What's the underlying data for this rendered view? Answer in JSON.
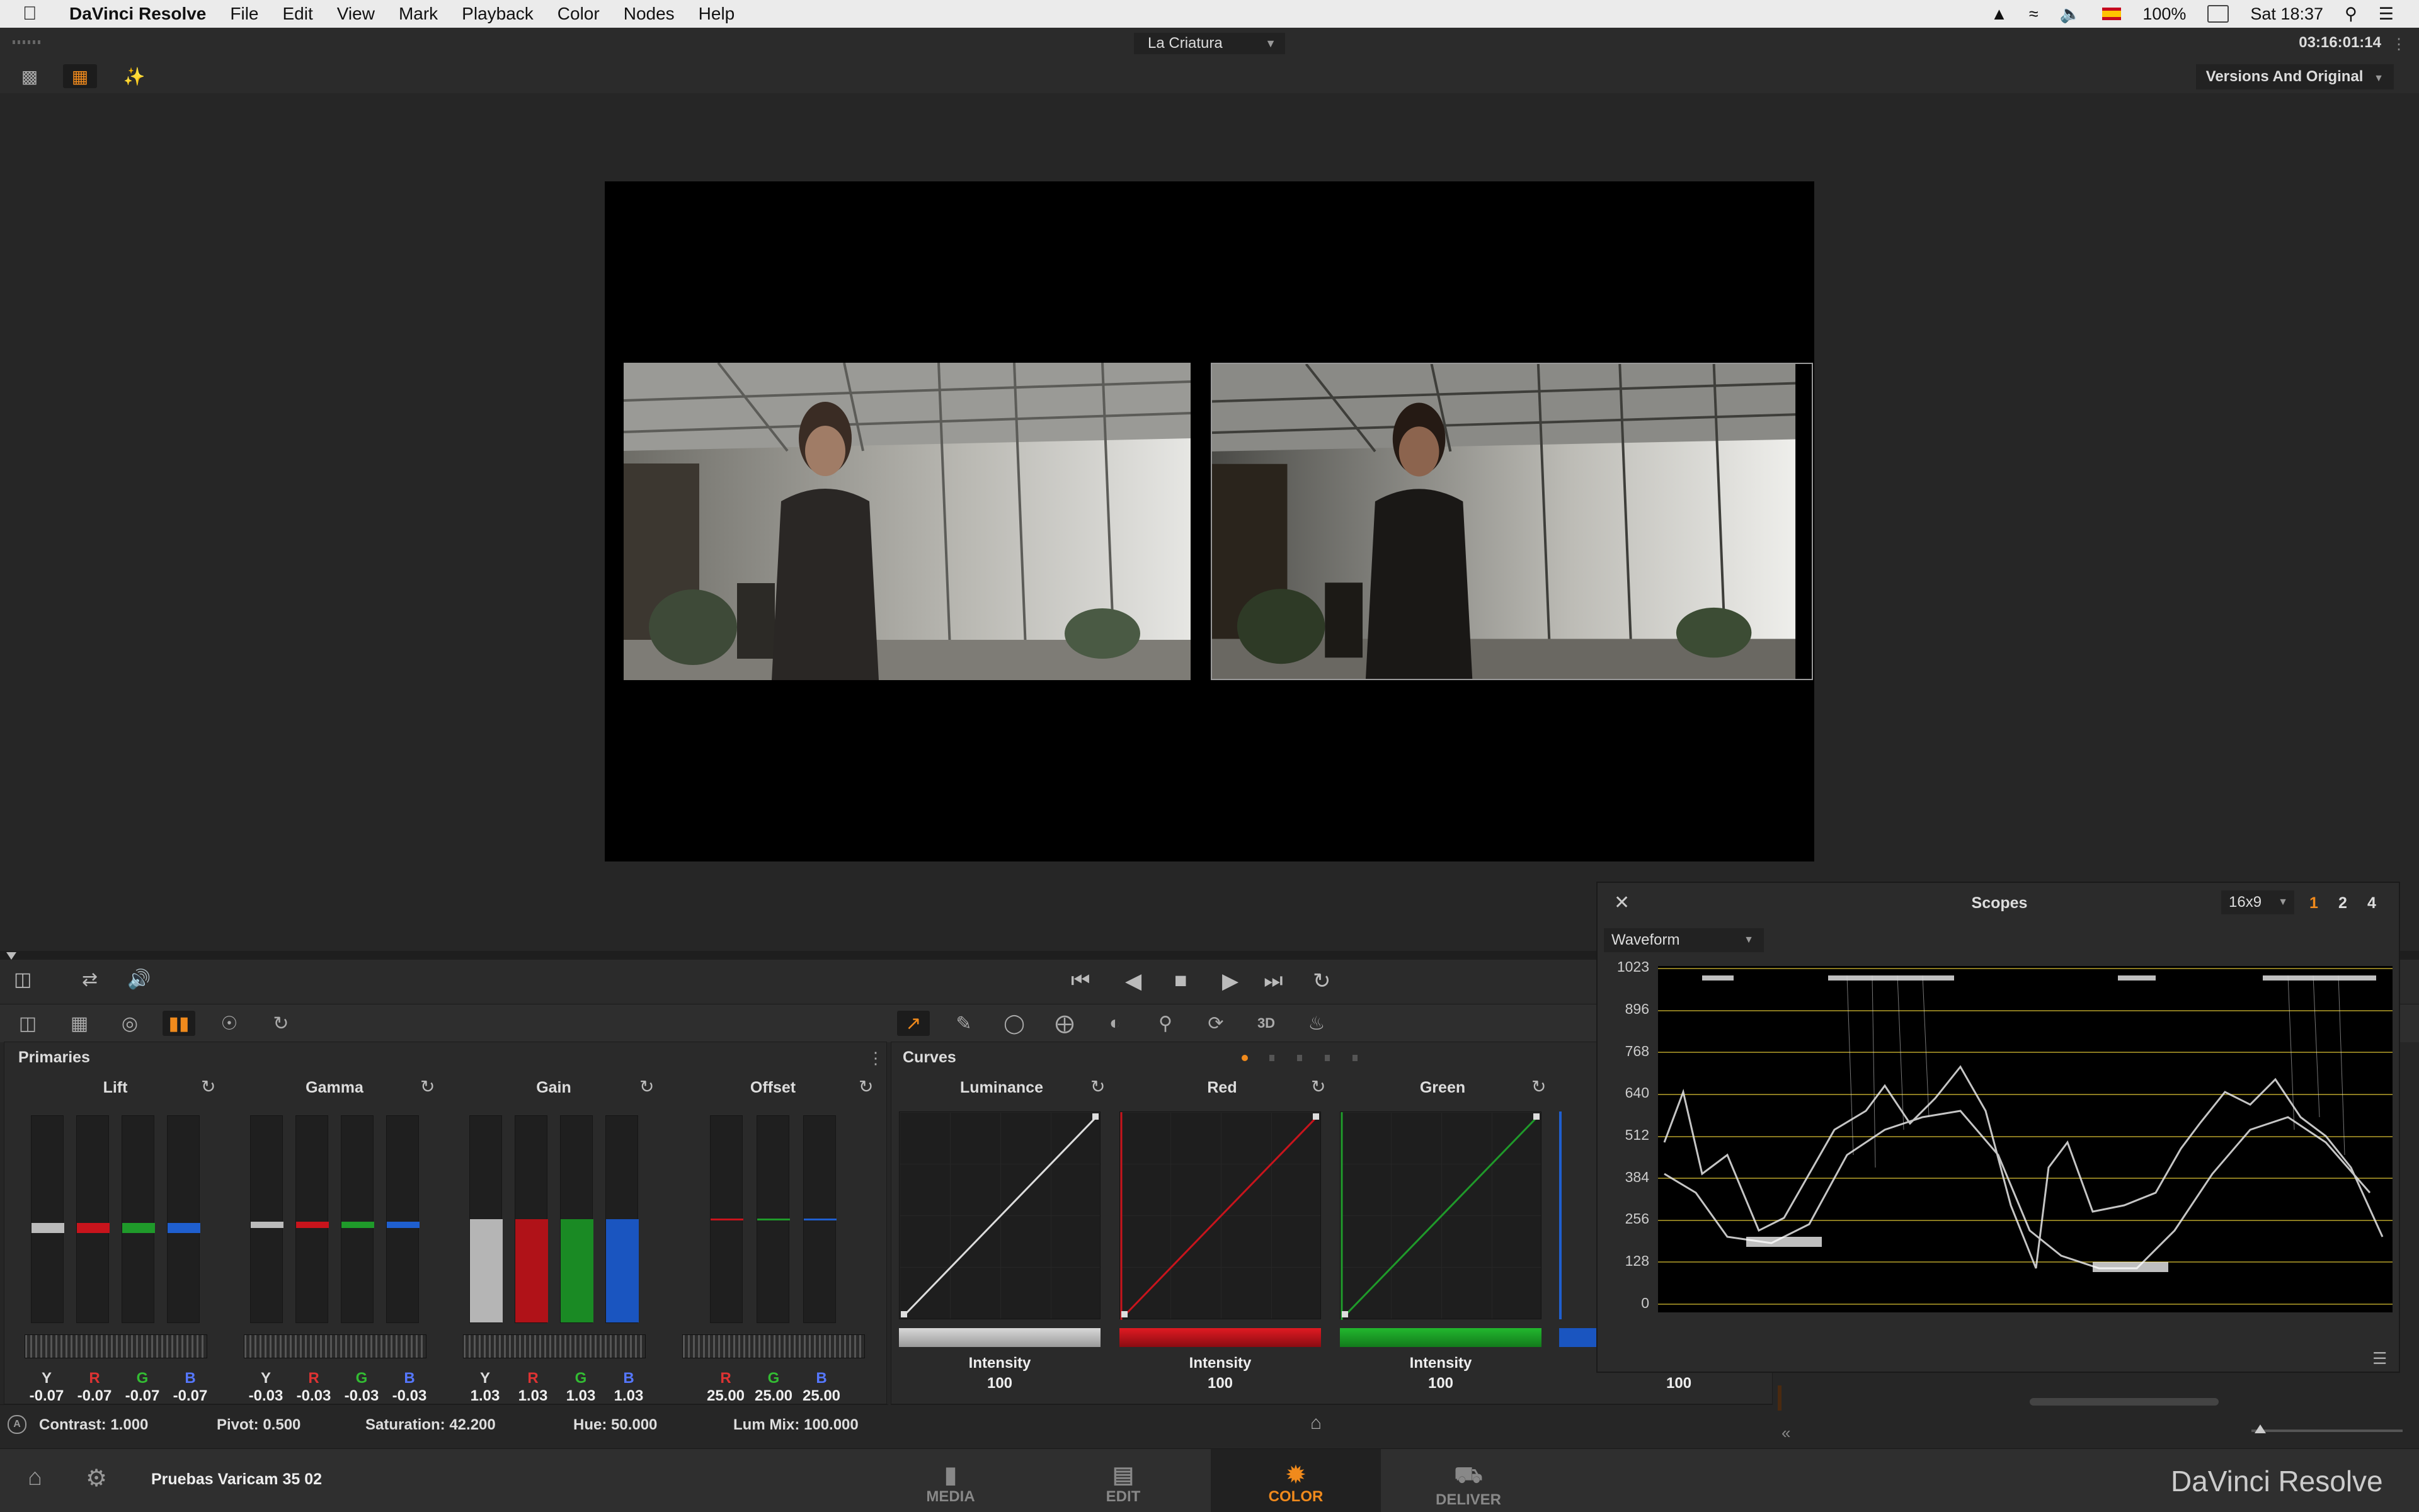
{
  "menubar": {
    "app_name": "DaVinci Resolve",
    "items": [
      "File",
      "Edit",
      "View",
      "Mark",
      "Playback",
      "Color",
      "Nodes",
      "Help"
    ],
    "battery": "100%",
    "clock": "Sat 18:37"
  },
  "titlebar": {
    "project": "La Criatura",
    "timecode": "03:16:01:14",
    "viewer_mode": "Versions And Original"
  },
  "primaries": {
    "title": "Primaries",
    "wheels": [
      {
        "name": "Lift",
        "channels": [
          "Y",
          "R",
          "G",
          "B"
        ],
        "values": [
          "-0.07",
          "-0.07",
          "-0.07",
          "-0.07"
        ]
      },
      {
        "name": "Gamma",
        "channels": [
          "Y",
          "R",
          "G",
          "B"
        ],
        "values": [
          "-0.03",
          "-0.03",
          "-0.03",
          "-0.03"
        ]
      },
      {
        "name": "Gain",
        "channels": [
          "Y",
          "R",
          "G",
          "B"
        ],
        "values": [
          "1.03",
          "1.03",
          "1.03",
          "1.03"
        ]
      },
      {
        "name": "Offset",
        "channels": [
          "R",
          "G",
          "B"
        ],
        "values": [
          "25.00",
          "25.00",
          "25.00"
        ]
      }
    ]
  },
  "curves": {
    "title": "Curves",
    "channels": [
      {
        "name": "Luminance",
        "intensity_label": "Intensity",
        "intensity": "100"
      },
      {
        "name": "Red",
        "intensity_label": "Intensity",
        "intensity": "100"
      },
      {
        "name": "Green",
        "intensity_label": "Intensity",
        "intensity": "100"
      }
    ],
    "extra_intensity": "100"
  },
  "adjustments": {
    "contrast": "Contrast: 1.000",
    "pivot": "Pivot: 0.500",
    "saturation": "Saturation: 42.200",
    "hue": "Hue: 50.000",
    "lum_mix": "Lum Mix: 100.000"
  },
  "scopes": {
    "title": "Scopes",
    "aspect": "16x9",
    "views": [
      "1",
      "2",
      "4"
    ],
    "active_view": "1",
    "type": "Waveform",
    "scale": [
      "1023",
      "896",
      "768",
      "640",
      "512",
      "384",
      "256",
      "128",
      "0"
    ]
  },
  "pagebar": {
    "clip_name": "Pruebas Varicam 35 02",
    "pages": [
      {
        "label": "MEDIA"
      },
      {
        "label": "EDIT"
      },
      {
        "label": "COLOR"
      },
      {
        "label": "DELIVER"
      }
    ],
    "active_page": "COLOR",
    "brand": "DaVinci Resolve"
  },
  "colors": {
    "accent": "#f08a1c",
    "red": "#c8141c",
    "green": "#1f9a2a",
    "blue": "#1f5fcf"
  },
  "icons": [
    "apple-icon",
    "gear-icon",
    "home-icon",
    "play-icon",
    "stop-icon",
    "rewind-icon",
    "fast-forward-icon",
    "loop-icon",
    "close-icon",
    "reset-icon"
  ]
}
